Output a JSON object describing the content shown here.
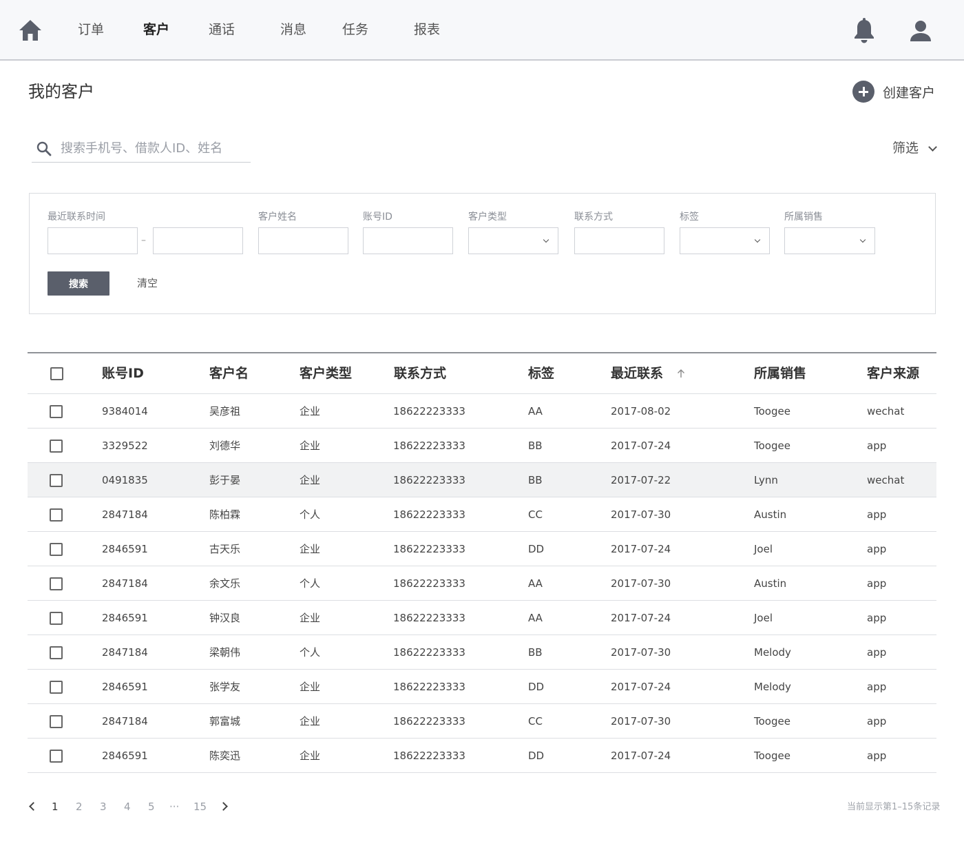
{
  "nav": {
    "items": [
      {
        "label": "订单"
      },
      {
        "label": "客户"
      },
      {
        "label": "通话"
      },
      {
        "label": "消息"
      },
      {
        "label": "任务"
      },
      {
        "label": "报表"
      }
    ],
    "active": "客户"
  },
  "page": {
    "title": "我的客户",
    "create_label": "创建客户"
  },
  "search": {
    "placeholder": "搜索手机号、借款人ID、姓名",
    "value": ""
  },
  "filter_toggle": "筛选",
  "filters": {
    "labels": [
      "最近联系时间",
      "客户姓名",
      "账号ID",
      "客户类型",
      "联系方式",
      "标签",
      "所属销售"
    ],
    "range_separator": "–",
    "search_button": "搜索",
    "clear_button": "清空"
  },
  "table": {
    "headers": [
      "账号ID",
      "客户名",
      "客户类型",
      "联系方式",
      "标签",
      "最近联系",
      "所属销售",
      "客户来源"
    ],
    "sorted_by": "最近联系",
    "sort_direction": "ascending",
    "rows": [
      {
        "id": "9384014",
        "name": "吴彦祖",
        "type": "企业",
        "phone": "18622223333",
        "tag": "AA",
        "last": "2017-08-02",
        "sales": "Toogee",
        "source": "wechat"
      },
      {
        "id": "3329522",
        "name": "刘德华",
        "type": "企业",
        "phone": "18622223333",
        "tag": "BB",
        "last": "2017-07-24",
        "sales": "Toogee",
        "source": "app"
      },
      {
        "id": "0491835",
        "name": "彭于晏",
        "type": "企业",
        "phone": "18622223333",
        "tag": "BB",
        "last": "2017-07-22",
        "sales": "Lynn",
        "source": "wechat"
      },
      {
        "id": "2847184",
        "name": "陈柏霖",
        "type": "个人",
        "phone": "18622223333",
        "tag": "CC",
        "last": "2017-07-30",
        "sales": "Austin",
        "source": "app"
      },
      {
        "id": "2846591",
        "name": "古天乐",
        "type": "企业",
        "phone": "18622223333",
        "tag": "DD",
        "last": "2017-07-24",
        "sales": "Joel",
        "source": "app"
      },
      {
        "id": "2847184",
        "name": "余文乐",
        "type": "个人",
        "phone": "18622223333",
        "tag": "AA",
        "last": "2017-07-30",
        "sales": "Austin",
        "source": "app"
      },
      {
        "id": "2846591",
        "name": "钟汉良",
        "type": "企业",
        "phone": "18622223333",
        "tag": "AA",
        "last": "2017-07-24",
        "sales": "Joel",
        "source": "app"
      },
      {
        "id": "2847184",
        "name": "梁朝伟",
        "type": "个人",
        "phone": "18622223333",
        "tag": "BB",
        "last": "2017-07-30",
        "sales": "Melody",
        "source": "app"
      },
      {
        "id": "2846591",
        "name": "张学友",
        "type": "企业",
        "phone": "18622223333",
        "tag": "DD",
        "last": "2017-07-24",
        "sales": "Melody",
        "source": "app"
      },
      {
        "id": "2847184",
        "name": "郭富城",
        "type": "企业",
        "phone": "18622223333",
        "tag": "CC",
        "last": "2017-07-30",
        "sales": "Toogee",
        "source": "app"
      },
      {
        "id": "2846591",
        "name": "陈奕迅",
        "type": "企业",
        "phone": "18622223333",
        "tag": "DD",
        "last": "2017-07-24",
        "sales": "Toogee",
        "source": "app"
      }
    ],
    "highlighted_row": 2
  },
  "pagination": {
    "pages": [
      "1",
      "2",
      "3",
      "4",
      "5",
      "···",
      "15"
    ],
    "current": "1",
    "info": "当前显示第1–15条记录"
  },
  "colors": {
    "nav_bg": "#f7f8fa",
    "primary_dark": "#5a5f6b",
    "row_highlight": "#f1f2f3",
    "border": "#dcdee2"
  },
  "icons": {
    "nav_left": "home-icon",
    "nav_right": [
      "bell-icon",
      "user-icon"
    ],
    "search": "search-icon",
    "create": "plus-circle-icon",
    "sort": "arrow-up-icon"
  }
}
